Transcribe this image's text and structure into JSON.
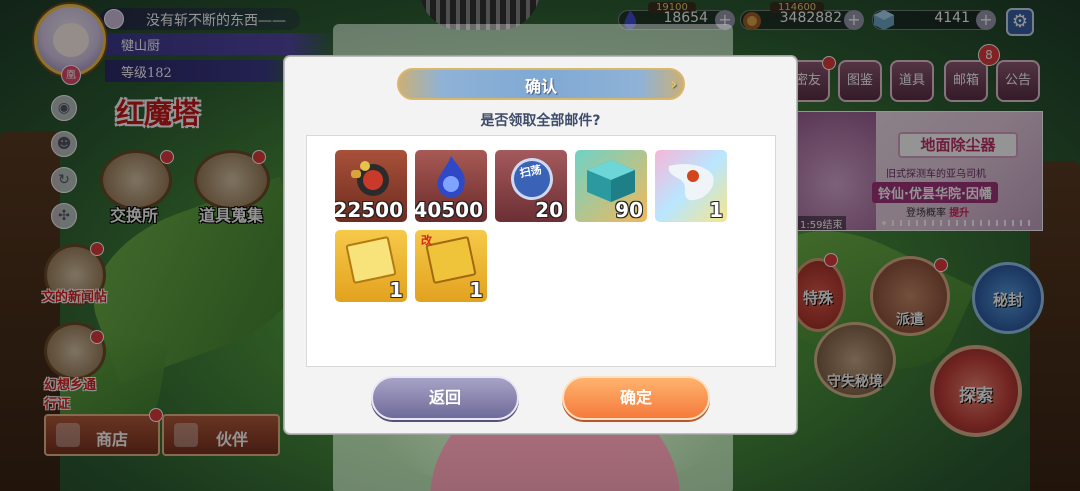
{
  "player": {
    "message": "没有斩不断的东西——",
    "name": "犍山厨",
    "level": "等级182",
    "badge": "凰"
  },
  "resources": [
    {
      "name": "resource-1",
      "value": "18654",
      "cap": "19100"
    },
    {
      "name": "resource-2",
      "value": "3482882",
      "cap": "114600"
    },
    {
      "name": "resource-3",
      "value": "4141"
    }
  ],
  "left_menu": {
    "tower": "红魔塔",
    "exchange": "交换所",
    "items_collect": "道具蒐集",
    "news": "文的新闻帖",
    "pass": "幻想乡通行证",
    "shop": "商店",
    "partner": "伙伴"
  },
  "right_menu": {
    "friends": "密友",
    "archive": "图鉴",
    "items": "道具",
    "mail": "邮箱",
    "mail_badge": "8",
    "notice": "公告",
    "special": "特殊",
    "dispatch": "派遣",
    "secret": "秘封",
    "lost_realm": "守失秘境",
    "explore": "探索"
  },
  "banner": {
    "title": "地面除尘器",
    "line1": "旧式探测车的亚乌司机",
    "line2": "铃仙·优昙华院·因幡",
    "line3_prefix": "登场概率",
    "line3_emph": "提升",
    "timer": "1:59结束"
  },
  "dialog": {
    "title": "确认",
    "question": "是否领取全部邮件?",
    "items": [
      {
        "name": "coin-bag-item",
        "count": "22500"
      },
      {
        "name": "blue-flame-item",
        "count": "40500"
      },
      {
        "name": "sweep-ticket-item",
        "count": "20",
        "label": "扫荡"
      },
      {
        "name": "cube-item",
        "count": "90"
      },
      {
        "name": "spirit-item",
        "count": "1"
      },
      {
        "name": "book-item",
        "count": "1"
      },
      {
        "name": "book-item-2",
        "count": "1",
        "label": "改"
      }
    ],
    "back_label": "返回",
    "ok_label": "确定"
  },
  "colors": {
    "accent_ok": "#f57a3c",
    "accent_back": "#6f6b99",
    "title_text": "#3f4d6a"
  }
}
